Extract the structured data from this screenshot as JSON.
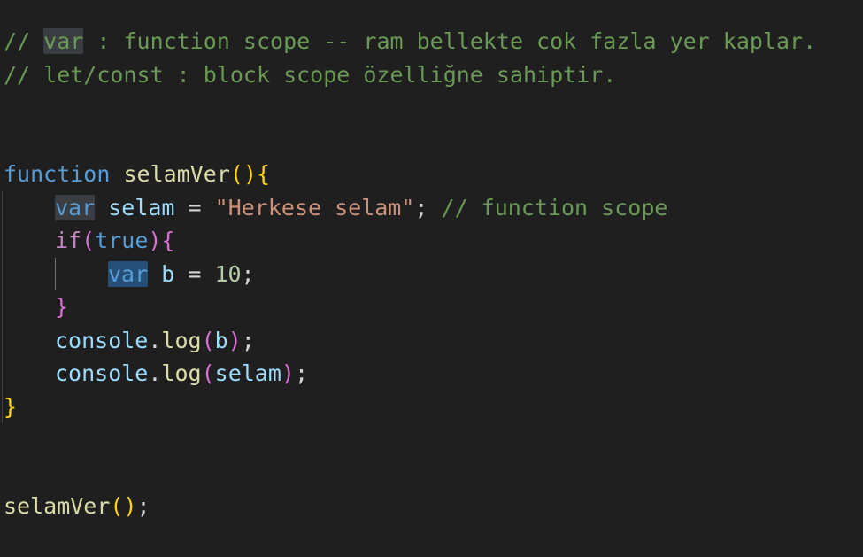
{
  "code": {
    "comment_line_1": {
      "slashes": "// ",
      "highlight_word": "var",
      "rest": " : function scope -- ram bellekte cok fazla yer kaplar."
    },
    "comment_line_2": "// let/const : block scope özelliğne sahiptir.",
    "function_decl": {
      "keyword": "function",
      "name": "selamVer",
      "open_paren": "(",
      "close_paren": ")",
      "open_brace": "{"
    },
    "var_decl": {
      "keyword": "var",
      "name": "selam",
      "eq": " = ",
      "value": "\"Herkese selam\"",
      "semi": ";",
      "comment": "// function scope"
    },
    "if_stmt": {
      "keyword": "if",
      "open_paren": "(",
      "condition": "true",
      "close_paren": ")",
      "open_brace": "{"
    },
    "inner_decl": {
      "keyword": "var",
      "name": "b",
      "eq": " = ",
      "value": "10",
      "semi": ";"
    },
    "if_close": "}",
    "log1": {
      "object": "console",
      "dot": ".",
      "method": "log",
      "open_paren": "(",
      "arg": "b",
      "close_paren": ")",
      "semi": ";"
    },
    "log2": {
      "object": "console",
      "dot": ".",
      "method": "log",
      "open_paren": "(",
      "arg": "selam",
      "close_paren": ")",
      "semi": ";"
    },
    "function_close": "}",
    "call": {
      "name": "selamVer",
      "parens": "()",
      "semi": ";"
    }
  },
  "colors": {
    "background": "#1f1f1f",
    "comment": "#6a9955",
    "keyword": "#569cd6",
    "function": "#dcdcaa",
    "variable": "#9cdcfe",
    "string": "#ce9178",
    "number": "#b5cea8",
    "control": "#c586c0",
    "bracket_level_1": "#ffd700",
    "bracket_level_2": "#da70d6",
    "bracket_level_3": "#179fff"
  }
}
